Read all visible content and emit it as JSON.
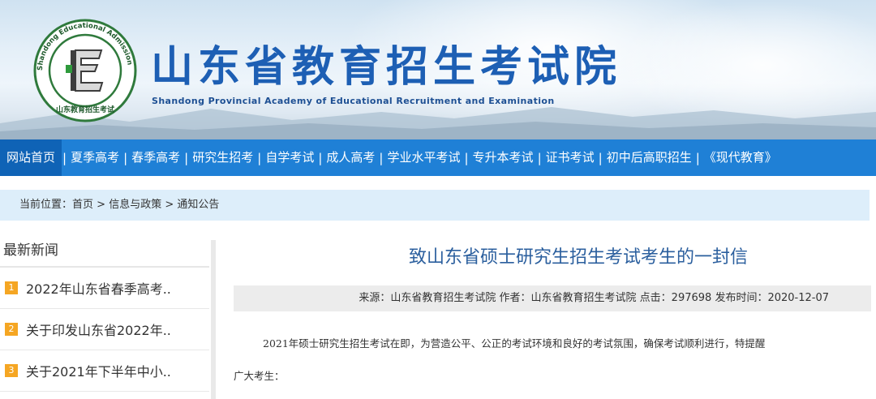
{
  "header": {
    "logo_ring_text": "Shandong Educational Admission & Examinations",
    "logo_chinese": "山东教育招生考试",
    "title": "山东省教育招生考试院",
    "subtitle": "Shandong Provincial Academy of Educational Recruitment and Examination"
  },
  "nav": {
    "items": [
      {
        "label": "网站首页"
      },
      {
        "label": "夏季高考"
      },
      {
        "label": "春季高考"
      },
      {
        "label": "研究生招考"
      },
      {
        "label": "自学考试"
      },
      {
        "label": "成人高考"
      },
      {
        "label": "学业水平考试"
      },
      {
        "label": "专升本考试"
      },
      {
        "label": "证书考试"
      },
      {
        "label": "初中后高职招生"
      },
      {
        "label": "《现代教育》"
      }
    ],
    "separator": "|"
  },
  "breadcrumb": {
    "prefix": "当前位置：",
    "items": [
      "首页",
      "信息与政策",
      "通知公告"
    ],
    "separator": " > "
  },
  "sidebar": {
    "title": "最新新闻",
    "news": [
      {
        "num": "1",
        "text": "2022年山东省春季高考.."
      },
      {
        "num": "2",
        "text": "关于印发山东省2022年.."
      },
      {
        "num": "3",
        "text": "关于2021年下半年中小.."
      }
    ]
  },
  "article": {
    "title": "致山东省硕士研究生招生考试考生的一封信",
    "meta": "来源：山东省教育招生考试院 作者：山东省教育招生考试院 点击：297698 发布时间：2020-12-07",
    "para1_line1": "2021年硕士研究生招生考试在即，为营造公平、公正的考试环境和良好的考试氛围，确保考试顺利进行，特提醒",
    "para1_line2": "广大考生："
  },
  "colors": {
    "nav_bg": "#1f80d6",
    "nav_active": "#0f63b6",
    "title_blue": "#1d5fb4",
    "badge_orange": "#f5a623",
    "crumb_bg": "#ddeefa"
  }
}
